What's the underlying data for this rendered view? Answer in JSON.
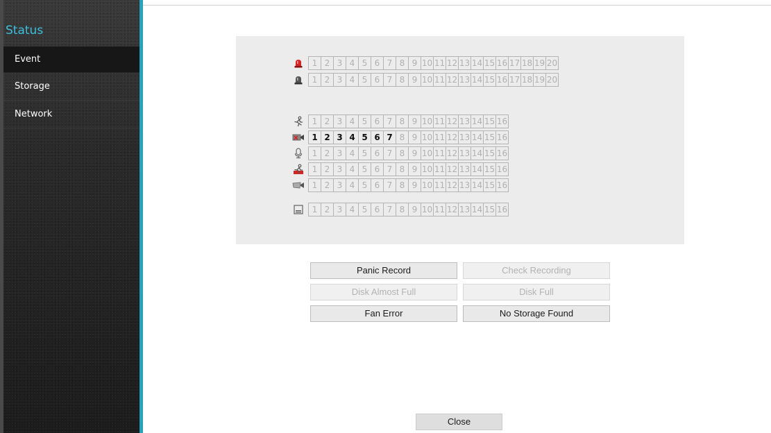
{
  "sidebar": {
    "title": "Status",
    "items": [
      {
        "label": "Event",
        "active": true
      },
      {
        "label": "Storage",
        "active": false
      },
      {
        "label": "Network",
        "active": false
      }
    ]
  },
  "colors": {
    "accent": "#27a3bd",
    "active_text": "#111111",
    "inactive_text": "#b0b0b0"
  },
  "status_rows": [
    {
      "name": "alarm-in",
      "icon": "red-siren-icon",
      "count": 20,
      "active": []
    },
    {
      "name": "alarm-out",
      "icon": "gray-siren-icon",
      "count": 20,
      "active": []
    },
    {
      "name": "motion",
      "icon": "running-person-icon",
      "count": 16,
      "active": []
    },
    {
      "name": "video-loss",
      "icon": "camera-off-icon",
      "count": 16,
      "active": [
        1,
        2,
        3,
        4,
        5,
        6,
        7
      ]
    },
    {
      "name": "audio",
      "icon": "microphone-icon",
      "count": 16,
      "active": []
    },
    {
      "name": "intrusion",
      "icon": "intrusion-person-icon",
      "count": 16,
      "active": []
    },
    {
      "name": "tamper",
      "icon": "camera-tamper-icon",
      "count": 16,
      "active": []
    },
    {
      "name": "text-in",
      "icon": "text-box-icon",
      "count": 16,
      "active": []
    }
  ],
  "events": {
    "panic_record": {
      "label": "Panic Record",
      "active": true
    },
    "check_recording": {
      "label": "Check Recording",
      "active": false
    },
    "disk_almost_full": {
      "label": "Disk Almost Full",
      "active": false
    },
    "disk_full": {
      "label": "Disk Full",
      "active": false
    },
    "fan_error": {
      "label": "Fan Error",
      "active": true
    },
    "no_storage_found": {
      "label": "No Storage Found",
      "active": true
    }
  },
  "footer": {
    "close_label": "Close"
  }
}
